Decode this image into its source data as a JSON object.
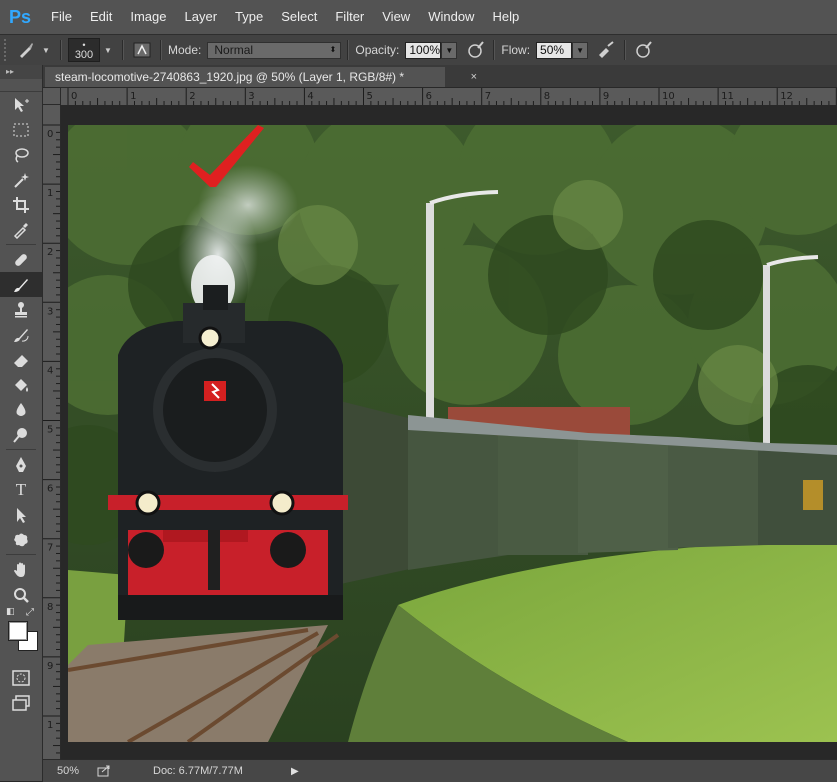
{
  "app": {
    "logo": "Ps"
  },
  "menu": [
    "File",
    "Edit",
    "Image",
    "Layer",
    "Type",
    "Select",
    "Filter",
    "View",
    "Window",
    "Help"
  ],
  "options_bar": {
    "brush_size": "300",
    "mode_label": "Mode:",
    "mode_value": "Normal",
    "opacity_label": "Opacity:",
    "opacity_value": "100%",
    "flow_label": "Flow:",
    "flow_value": "50%"
  },
  "document_tab": {
    "title": "steam-locomotive-2740863_1920.jpg @ 50% (Layer 1, RGB/8#) *",
    "close": "×"
  },
  "rulers": {
    "h_labels": [
      "0",
      "1",
      "2",
      "3",
      "4",
      "5",
      "6",
      "7",
      "8",
      "9",
      "10",
      "11",
      "12"
    ],
    "v_labels": [
      "0",
      "1",
      "2",
      "3",
      "4",
      "5",
      "6",
      "7",
      "8",
      "9",
      "1"
    ]
  },
  "status": {
    "zoom": "50%",
    "doc_info": "Doc: 6.77M/7.77M",
    "arrow": "▶"
  },
  "toolbar": {
    "collapse": "▸▸",
    "tools": [
      "move-tool",
      "marquee-tool",
      "lasso-tool",
      "magic-wand-tool",
      "crop-tool",
      "eyedropper-tool",
      "healing-brush-tool",
      "brush-tool",
      "clone-stamp-tool",
      "history-brush-tool",
      "eraser-tool",
      "paint-bucket-tool",
      "blur-tool",
      "dodge-tool",
      "pen-tool",
      "type-tool",
      "path-selection-tool",
      "shape-tool",
      "hand-tool",
      "zoom-tool"
    ]
  },
  "colors": {
    "foreground": "#ffffff",
    "background": "#ffffff",
    "check_mark": "#e02020",
    "accent": "#31a8ff"
  }
}
